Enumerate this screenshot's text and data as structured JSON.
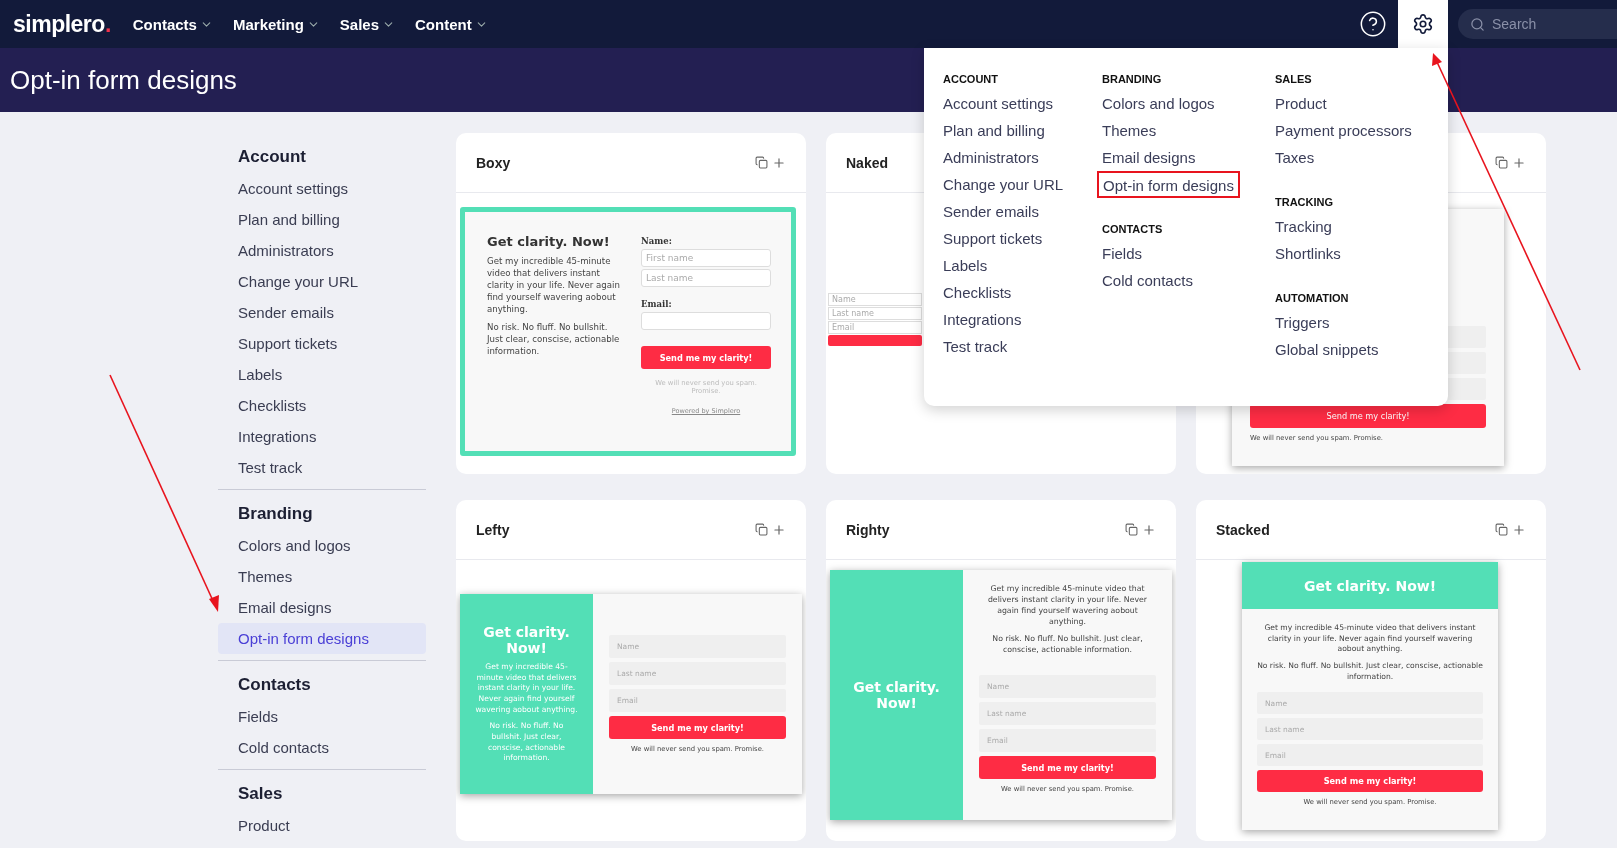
{
  "nav": {
    "logo": "simplero",
    "logo_dot": ".",
    "menus": [
      "Contacts",
      "Marketing",
      "Sales",
      "Content"
    ],
    "search": {
      "placeholder": "Search"
    },
    "settings_open": true
  },
  "page_title": "Opt-in form designs",
  "sidebar": [
    {
      "title": "Account",
      "items": [
        {
          "label": "Account settings",
          "selected": false
        },
        {
          "label": "Plan and billing",
          "selected": false
        },
        {
          "label": "Administrators",
          "selected": false
        },
        {
          "label": "Change your URL",
          "selected": false
        },
        {
          "label": "Sender emails",
          "selected": false
        },
        {
          "label": "Support tickets",
          "selected": false
        },
        {
          "label": "Labels",
          "selected": false
        },
        {
          "label": "Checklists",
          "selected": false
        },
        {
          "label": "Integrations",
          "selected": false
        },
        {
          "label": "Test track",
          "selected": false
        }
      ]
    },
    {
      "title": "Branding",
      "items": [
        {
          "label": "Colors and logos",
          "selected": false
        },
        {
          "label": "Themes",
          "selected": false
        },
        {
          "label": "Email designs",
          "selected": false
        },
        {
          "label": "Opt-in form designs",
          "selected": true
        }
      ]
    },
    {
      "title": "Contacts",
      "items": [
        {
          "label": "Fields",
          "selected": false
        },
        {
          "label": "Cold contacts",
          "selected": false
        }
      ]
    },
    {
      "title": "Sales",
      "items": [
        {
          "label": "Product",
          "selected": false
        }
      ]
    }
  ],
  "cards": [
    {
      "kind": "boxy",
      "title": "Boxy",
      "preview": {
        "heading": "Get clarity. Now!",
        "paragraphs": [
          "Get my incredible 45-minute video that delivers instant clarity in your life. Never again find yourself wavering aobout anything.",
          "No risk. No fluff. No bullshit. Just clear, conscise, actionable information."
        ],
        "name_label": "Name:",
        "placeholders": [
          "First name",
          "Last name"
        ],
        "email_label": "Email:",
        "button": "Send me my clarity!",
        "note": "We will never send you spam. Promise.",
        "powered": "Powered by Simplero"
      }
    },
    {
      "kind": "naked",
      "title": "Naked",
      "preview": {
        "placeholders": [
          "Name",
          "Last name",
          "Email"
        ]
      }
    },
    {
      "kind": "partial",
      "preview": {
        "button": "Send me my clarity!",
        "note": "We will never send you spam. Promise."
      }
    },
    {
      "kind": "lefty",
      "title": "Lefty",
      "preview": {
        "heading": "Get clarity. Now!",
        "paragraphs": [
          "Get my incredible 45-minute video that delivers instant clarity in your life. Never again find yourself wavering aobout anything.",
          "No risk. No fluff. No bullshit. Just clear, conscise, actionable information."
        ],
        "placeholders": [
          "Name",
          "Last name",
          "Email"
        ],
        "button": "Send me my clarity!",
        "note": "We will never send you spam. Promise."
      }
    },
    {
      "kind": "righty",
      "title": "Righty",
      "preview": {
        "heading": "Get clarity. Now!",
        "paragraphs": [
          "Get my incredible 45-minute video that delivers instant clarity in your life. Never again find yourself wavering aobout anything.",
          "No risk. No fluff. No bullshit. Just clear, conscise, actionable information."
        ],
        "placeholders": [
          "Name",
          "Last name",
          "Email"
        ],
        "button": "Send me my clarity!",
        "note": "We will never send you spam. Promise."
      }
    },
    {
      "kind": "stacked",
      "title": "Stacked",
      "preview": {
        "heading": "Get clarity. Now!",
        "paragraphs": [
          "Get my incredible 45-minute video that delivers instant clarity in your life. Never again find yourself wavering aobout anything.",
          "No risk. No fluff. No bullshit. Just clear, conscise, actionable information."
        ],
        "placeholders": [
          "Name",
          "Last name",
          "Email"
        ],
        "button": "Send me my clarity!",
        "note": "We will never send you spam. Promise."
      }
    }
  ],
  "settings_menu": [
    [
      {
        "title": "ACCOUNT",
        "items": [
          {
            "label": "Account settings",
            "highlighted": false
          },
          {
            "label": "Plan and billing",
            "highlighted": false
          },
          {
            "label": "Administrators",
            "highlighted": false
          },
          {
            "label": "Change your URL",
            "highlighted": false
          },
          {
            "label": "Sender emails",
            "highlighted": false
          },
          {
            "label": "Support tickets",
            "highlighted": false
          },
          {
            "label": "Labels",
            "highlighted": false
          },
          {
            "label": "Checklists",
            "highlighted": false
          },
          {
            "label": "Integrations",
            "highlighted": false
          },
          {
            "label": "Test track",
            "highlighted": false
          }
        ]
      }
    ],
    [
      {
        "title": "BRANDING",
        "items": [
          {
            "label": "Colors and logos",
            "highlighted": false
          },
          {
            "label": "Themes",
            "highlighted": false
          },
          {
            "label": "Email designs",
            "highlighted": false
          },
          {
            "label": "Opt-in form designs",
            "highlighted": true
          }
        ]
      },
      {
        "title": "CONTACTS",
        "items": [
          {
            "label": "Fields",
            "highlighted": false
          },
          {
            "label": "Cold contacts",
            "highlighted": false
          }
        ]
      }
    ],
    [
      {
        "title": "SALES",
        "items": [
          {
            "label": "Product",
            "highlighted": false
          },
          {
            "label": "Payment processors",
            "highlighted": false
          },
          {
            "label": "Taxes",
            "highlighted": false
          }
        ]
      },
      {
        "title": "TRACKING",
        "items": [
          {
            "label": "Tracking",
            "highlighted": false
          },
          {
            "label": "Shortlinks",
            "highlighted": false
          }
        ]
      },
      {
        "title": "AUTOMATION",
        "items": [
          {
            "label": "Triggers",
            "highlighted": false
          },
          {
            "label": "Global snippets",
            "highlighted": false
          }
        ]
      }
    ]
  ]
}
